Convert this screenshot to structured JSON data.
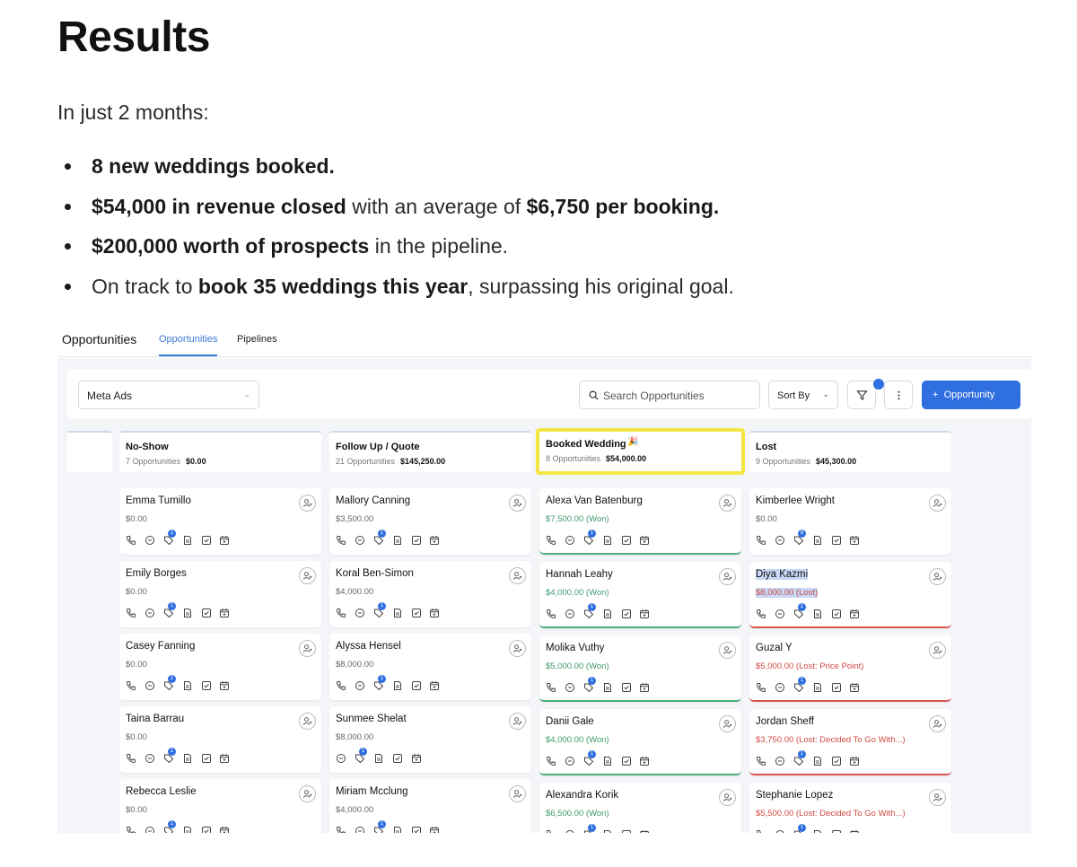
{
  "article": {
    "title": "Results",
    "intro": "In just 2 months:",
    "bullets": [
      {
        "b1": "8 new weddings booked."
      },
      {
        "b1": "$54,000 in revenue closed",
        "t1": " with an average of ",
        "b2": "$6,750 per booking."
      },
      {
        "b1": "$200,000 worth of prospects",
        "t1": " in the pipeline."
      },
      {
        "t0": "On track to ",
        "b1": "book 35 weddings this year",
        "t1": ", surpassing his original goal."
      }
    ]
  },
  "app": {
    "title": "Opportunities",
    "tabs": [
      "Opportunities",
      "Pipelines"
    ],
    "active_tab": "Opportunities",
    "pipeline_select": "Meta Ads",
    "search_placeholder": "Search Opportunities",
    "sort_label": "Sort By",
    "add_button_label": "Opportunity",
    "add_button_icon": "+",
    "accent_color": "#2f6fe0",
    "won_color": "#3d9a6a",
    "lost_color": "#d04a43",
    "highlight_color": "#f3e642"
  },
  "columns": [
    {
      "name": "No-Show",
      "count": "7 Opportunities",
      "total": "$0.00",
      "cards": [
        {
          "name": "Emma Tumillo",
          "value": "$0.00",
          "badge": "1"
        },
        {
          "name": "Emily Borges",
          "value": "$0.00",
          "badge": "1"
        },
        {
          "name": "Casey Fanning",
          "value": "$0.00",
          "badge": "1"
        },
        {
          "name": "Taina Barrau",
          "value": "$0.00",
          "badge": "1"
        },
        {
          "name": "Rebecca Leslie",
          "value": "$0.00",
          "badge": "1"
        }
      ]
    },
    {
      "name": "Follow Up / Quote",
      "count": "21 Opportunities",
      "total": "$145,250.00",
      "cards": [
        {
          "name": "Mallory Canning",
          "value": "$3,500.00",
          "badge": "1"
        },
        {
          "name": "Koral Ben-Simon",
          "value": "$4,000.00",
          "badge": "1"
        },
        {
          "name": "Alyssa Hensel",
          "value": "$8,000.00",
          "badge": "1"
        },
        {
          "name": "Sunmee Shelat",
          "value": "$8,000.00",
          "badge": "1"
        },
        {
          "name": "Miriam Mcclung",
          "value": "$4,000.00",
          "badge": "1"
        }
      ]
    },
    {
      "name": "Booked Wedding",
      "emoji": "🎉",
      "count": "8 Opportunities",
      "total": "$54,000.00",
      "cards": [
        {
          "name": "Alexa Van Batenburg",
          "value": "$7,500.00 (Won)",
          "badge": "1"
        },
        {
          "name": "Hannah Leahy",
          "value": "$4,000.00 (Won)",
          "badge": "1"
        },
        {
          "name": "Molika Vuthy",
          "value": "$5,000.00 (Won)",
          "badge": "1"
        },
        {
          "name": "Danii Gale",
          "value": "$4,000.00 (Won)",
          "badge": "1"
        },
        {
          "name": "Alexandra Korik",
          "value": "$6,500.00 (Won)",
          "badge": "1"
        }
      ]
    },
    {
      "name": "Lost",
      "count": "9 Opportunities",
      "total": "$45,300.00",
      "cards": [
        {
          "name": "Kimberlee Wright",
          "value": "$0.00",
          "badge": "8"
        },
        {
          "name": "Diya Kazmi",
          "value": "$8,000.00 (Lost)",
          "badge": "1"
        },
        {
          "name": "Guzal Y",
          "value": "$5,000.00 (Lost: Price Point)",
          "badge": "1"
        },
        {
          "name": "Jordan Sheff",
          "value": "$3,750.00 (Lost: Decided To Go With...)",
          "badge": "1"
        },
        {
          "name": "Stephanie Lopez",
          "value": "$5,500.00 (Lost: Decided To Go With...)",
          "badge": "1"
        }
      ]
    }
  ]
}
